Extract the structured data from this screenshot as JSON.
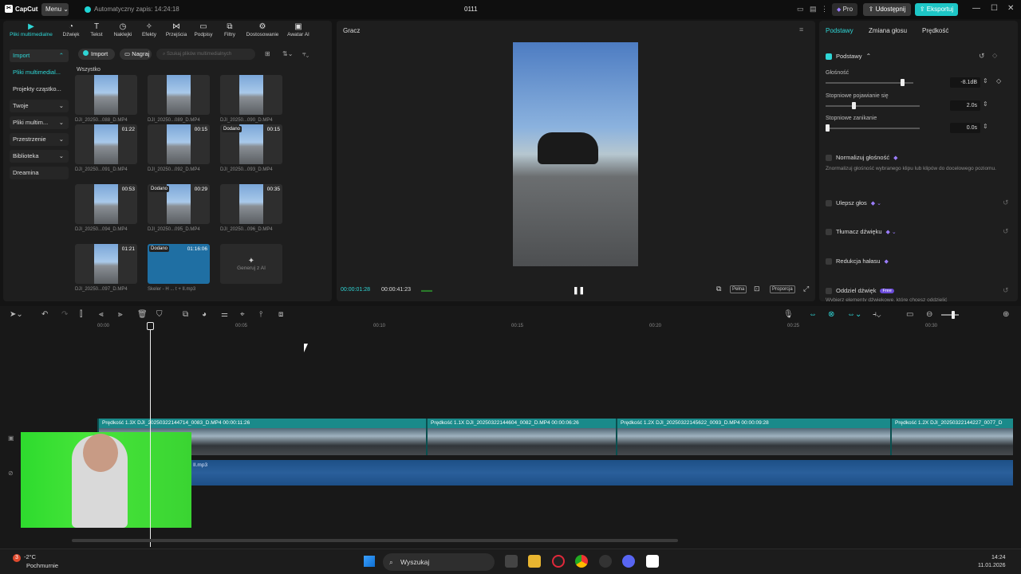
{
  "app": {
    "logo": "CapCut",
    "menu_label": "Menu",
    "autosave": "Automatyczny zapis: 14:24:18",
    "project_name": "0111",
    "pro_label": "Pro",
    "share_label": "Udostępnij",
    "export_label": "Eksportuj"
  },
  "colors": {
    "accent": "#2fd6d6",
    "export_bg": "#1dc6c6",
    "video_track": "#1d8f8f",
    "audio_track": "#2a5f9b"
  },
  "toptabs": [
    {
      "label": "Pliki multimedialne",
      "icon": "media-icon"
    },
    {
      "label": "Dźwięk",
      "icon": "audio-icon"
    },
    {
      "label": "Tekst",
      "icon": "text-icon"
    },
    {
      "label": "Naklejki",
      "icon": "sticker-icon"
    },
    {
      "label": "Efekty",
      "icon": "effects-icon"
    },
    {
      "label": "Przejścia",
      "icon": "transition-icon"
    },
    {
      "label": "Podpisy",
      "icon": "captions-icon"
    },
    {
      "label": "Filtry",
      "icon": "filter-icon"
    },
    {
      "label": "Dostosowanie",
      "icon": "adjust-icon"
    },
    {
      "label": "Awatar AI",
      "icon": "avatar-icon"
    }
  ],
  "sidenav": [
    {
      "label": "Import"
    },
    {
      "label": "Pliki multimedial..."
    },
    {
      "label": "Projekty cząstko..."
    },
    {
      "label": "Twoje"
    },
    {
      "label": "Pliki multim..."
    },
    {
      "label": "Przestrzenie"
    },
    {
      "label": "Biblioteka"
    },
    {
      "label": "Dreamina"
    }
  ],
  "media": {
    "import_label": "Import",
    "record_label": "Nagraj",
    "search_placeholder": "Szukaj plików multimedialnych",
    "all_label": "Wszystko",
    "genai_label": "Generuj z AI",
    "items": [
      {
        "name": "DJI_20250...088_D.MP4",
        "duration": "",
        "tag": ""
      },
      {
        "name": "DJI_20250...089_D.MP4",
        "duration": "",
        "tag": ""
      },
      {
        "name": "DJI_20250...090_D.MP4",
        "duration": "",
        "tag": ""
      },
      {
        "name": "DJI_20250...091_D.MP4",
        "duration": "01:22",
        "tag": ""
      },
      {
        "name": "DJI_20250...092_D.MP4",
        "duration": "00:15",
        "tag": ""
      },
      {
        "name": "DJI_20250...093_D.MP4",
        "duration": "00:15",
        "tag": "Dodano"
      },
      {
        "name": "DJI_20250...094_D.MP4",
        "duration": "00:53",
        "tag": ""
      },
      {
        "name": "DJI_20250...095_D.MP4",
        "duration": "00:29",
        "tag": "Dodano"
      },
      {
        "name": "DJI_20250...096_D.MP4",
        "duration": "00:35",
        "tag": ""
      },
      {
        "name": "DJI_20250...097_D.MP4",
        "duration": "01:21",
        "tag": ""
      },
      {
        "name": "Skeler - H ... t + II.mp3",
        "duration": "01:16:06",
        "tag": "Dodano"
      }
    ]
  },
  "player": {
    "title": "Gracz",
    "time_current": "00:00:01:28",
    "time_total": "00:00:41:23",
    "btn_full": "Pełna",
    "btn_ratio": "Proporcja"
  },
  "inspector": {
    "tabs": [
      "Podstawy",
      "Zmiana głosu",
      "Prędkość"
    ],
    "section": "Podstawy",
    "volume_label": "Głośność",
    "volume_value": "-8.1dB",
    "volume_level": 0.85,
    "fadein_label": "Stopniowe pojawianie się",
    "fadein_value": "2.0s",
    "fadein_level": 0.3,
    "fadeout_label": "Stopniowe zanikanie",
    "fadeout_value": "0.0s",
    "fadeout_level": 0.0,
    "normalize_label": "Normalizuj głośność",
    "normalize_desc": "Znormalizuj głośność wybranego klipu lub klipów do docelowego poziomu.",
    "enhance_label": "Ulepsz głos",
    "translate_label": "Tłumacz dźwięku",
    "noise_label": "Redukcja hałasu",
    "separate_label": "Oddziel dźwięk",
    "separate_badge": "Free",
    "separate_desc": "Wybierz elementy dźwiękowe, które chcesz oddzielić"
  },
  "timeline": {
    "ruler": [
      "00:00",
      "00:05",
      "00:10",
      "00:15",
      "00:20",
      "00:25",
      "00:30"
    ],
    "clips": [
      {
        "label": "Prędkość 1.3X  DJI_20250322144714_0083_D.MP4  00:00:11:26"
      },
      {
        "label": "Prędkość 1.1X  DJI_20250322144604_0082_D.MP4  00:00:06:26"
      },
      {
        "label": "Prędkość 1.2X  DJI_20250322145622_0093_D.MP4  00:00:09:28"
      },
      {
        "label": "Prędkość 1.2X  DJI_20250322144227_0077_D"
      }
    ],
    "audio_label": "II.mp3"
  },
  "taskbar": {
    "weather_temp": "-2°C",
    "weather_desc": "Pochmurnie",
    "weather_badge": "3",
    "search_label": "Wyszukaj",
    "time": "14:24",
    "date": "11.01.2026"
  }
}
